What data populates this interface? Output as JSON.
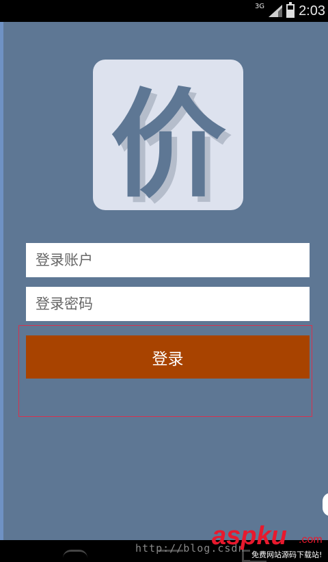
{
  "status_bar": {
    "network": "3G",
    "time": "2:03",
    "battery_level": 0.6
  },
  "logo": {
    "character": "价"
  },
  "login_form": {
    "account_placeholder": "登录账户",
    "password_placeholder": "登录密码",
    "login_label": "登录"
  },
  "watermark": {
    "url": "http://blog.csdn",
    "logo": "aspku",
    "logo_suffix": ".com",
    "slogan": "免费网站源码下载站!"
  }
}
